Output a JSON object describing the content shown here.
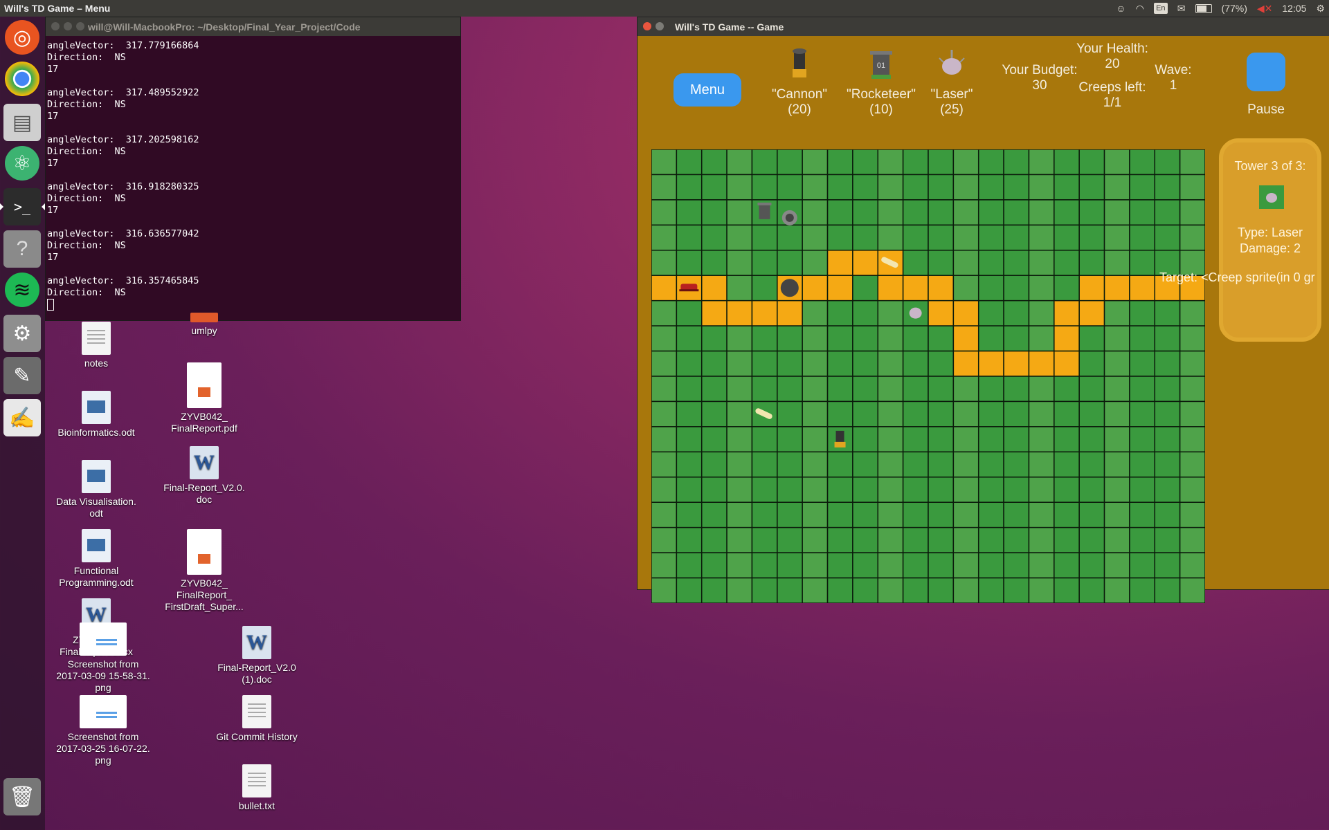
{
  "top_panel": {
    "app_title": "Will's TD Game – Menu",
    "keyboard": "En",
    "battery": "(77%)",
    "time": "12:05"
  },
  "launcher": {
    "items": [
      {
        "name": "ubuntu-icon",
        "color": "#e95420"
      },
      {
        "name": "chrome-icon",
        "color": "#4285f4"
      },
      {
        "name": "files-icon",
        "color": "#8a8a8a"
      },
      {
        "name": "atom-icon",
        "color": "#3cb371"
      },
      {
        "name": "terminal-icon",
        "color": "#2c2c2c"
      },
      {
        "name": "help-icon",
        "color": "#777777"
      },
      {
        "name": "spotify-icon",
        "color": "#1db954"
      },
      {
        "name": "settings-icon",
        "color": "#9a9a9a"
      },
      {
        "name": "gimp-icon",
        "color": "#6b6b6b"
      },
      {
        "name": "text-editor-icon",
        "color": "#5a5a5a"
      },
      {
        "name": "trash-icon",
        "color": "#666666"
      }
    ]
  },
  "terminal": {
    "title": "will@Will-MacbookPro: ~/Desktop/Final_Year_Project/Code",
    "lines": [
      "angleVector:  317.779166864",
      "Direction:  NS",
      "17",
      "",
      "angleVector:  317.489552922",
      "Direction:  NS",
      "17",
      "",
      "angleVector:  317.202598162",
      "Direction:  NS",
      "17",
      "",
      "angleVector:  316.918280325",
      "Direction:  NS",
      "17",
      "",
      "angleVector:  316.636577042",
      "Direction:  NS",
      "17",
      "",
      "angleVector:  316.357465845",
      "Direction:  NS"
    ]
  },
  "desktop": {
    "icons": [
      {
        "label": "notes",
        "type": "text-file"
      },
      {
        "label": "umlpy",
        "type": "orange"
      },
      {
        "label": "Bioinformatics.odt",
        "type": "odt"
      },
      {
        "label": "ZYVB042_\nFinalReport.pdf",
        "type": "pdf"
      },
      {
        "label": "Data Visualisation.\nodt",
        "type": "odt"
      },
      {
        "label": "Final-Report_V2.0.\ndoc",
        "type": "word"
      },
      {
        "label": "Functional\nProgramming.odt",
        "type": "odt"
      },
      {
        "label": "ZYVB042_\nFinalReport_\nFirstDraft_Super...",
        "type": "pdf"
      },
      {
        "label": "ZYVB042_\nFinalReport.docx",
        "type": "word"
      },
      {
        "label": "Screenshot from\n2017-03-09 15-58-31.\npng",
        "type": "png"
      },
      {
        "label": "Final-Report_V2.0\n(1).doc",
        "type": "word"
      },
      {
        "label": "Screenshot from\n2017-03-25 16-07-22.\npng",
        "type": "png"
      },
      {
        "label": "Git Commit History",
        "type": "text-file"
      },
      {
        "label": "bullet.txt",
        "type": "text-file"
      }
    ]
  },
  "game": {
    "title": "Will's TD Game -- Game",
    "menu_label": "Menu",
    "pause_label": "Pause",
    "towers": [
      {
        "name": "\"Cannon\"",
        "cost": "(20)"
      },
      {
        "name": "\"Rocketeer\"",
        "cost": "(10)"
      },
      {
        "name": "\"Laser\"",
        "cost": "(25)"
      }
    ],
    "budget_label": "Your Budget:",
    "budget_value": "30",
    "health_label": "Your Health:",
    "health_value": "20",
    "creeps_label": "Creeps left:",
    "creeps_value": "1/1",
    "wave_label": "Wave:",
    "wave_value": "1",
    "info": {
      "tower_count": "Tower 3 of 3:",
      "type": "Type: Laser",
      "damage": "Damage: 2",
      "target": "Target: <Creep sprite(in 0 gr"
    },
    "grid": {
      "cols": 22,
      "rows": 18,
      "colors": {
        "grass_a": "#3a9a3e",
        "grass_b": "#4fa34a",
        "path": "#f5a914",
        "line": "#0b1a0b"
      },
      "path_cells": [
        [
          7,
          4
        ],
        [
          8,
          4
        ],
        [
          9,
          4
        ],
        [
          0,
          5
        ],
        [
          1,
          5
        ],
        [
          2,
          5
        ],
        [
          5,
          5
        ],
        [
          6,
          5
        ],
        [
          7,
          5
        ],
        [
          9,
          5
        ],
        [
          10,
          5
        ],
        [
          11,
          5
        ],
        [
          17,
          5
        ],
        [
          18,
          5
        ],
        [
          19,
          5
        ],
        [
          20,
          5
        ],
        [
          21,
          5
        ],
        [
          2,
          6
        ],
        [
          3,
          6
        ],
        [
          4,
          6
        ],
        [
          5,
          6
        ],
        [
          11,
          6
        ],
        [
          12,
          6
        ],
        [
          16,
          6
        ],
        [
          17,
          6
        ],
        [
          12,
          7
        ],
        [
          16,
          7
        ],
        [
          12,
          8
        ],
        [
          13,
          8
        ],
        [
          14,
          8
        ],
        [
          15,
          8
        ],
        [
          16,
          8
        ]
      ]
    }
  }
}
